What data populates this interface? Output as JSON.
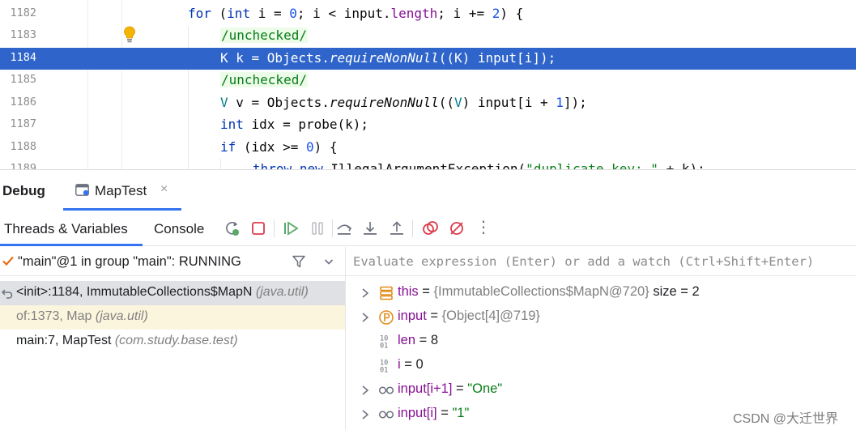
{
  "editor": {
    "lines": [
      {
        "number": "1182"
      },
      {
        "number": "1183"
      },
      {
        "number": "1184"
      },
      {
        "number": "1185"
      },
      {
        "number": "1186"
      },
      {
        "number": "1187"
      },
      {
        "number": "1188"
      },
      {
        "number": "1189"
      }
    ],
    "current_line": "1184",
    "code": {
      "l1182": {
        "kw_for": "for",
        "kw_int": "int",
        "rest1": " i = ",
        "zero": "0",
        "rest2": "; i < input.",
        "length": "length",
        "rest3": "; i += ",
        "two": "2",
        "rest4": ") {"
      },
      "l1183": {
        "comment": "/unchecked/"
      },
      "l1184": {
        "text": "K k = Objects.",
        "method": "requireNonNull",
        "rest": "((K) input[i]);"
      },
      "l1185": {
        "comment": "/unchecked/"
      },
      "l1186": {
        "type_v": "V",
        "rest1": " v = Objects.",
        "method": "requireNonNull",
        "rest2": "((",
        "cast_v": "V",
        "rest3": ") input[i + ",
        "one": "1",
        "rest4": "]);"
      },
      "l1187": {
        "kw_int": "int",
        "rest": " idx = probe(k);"
      },
      "l1188": {
        "kw_if": "if",
        "rest1": " (idx >= ",
        "zero": "0",
        "rest2": ") {"
      },
      "l1189": {
        "kw_throw": "throw",
        "kw_new": "new",
        "rest1": " IllegalArgumentException(",
        "str": "\"duplicate key: \"",
        "rest2": " + k);"
      }
    }
  },
  "debug": {
    "title": "Debug",
    "session_tab": "MapTest",
    "close_glyph": "×"
  },
  "toolbar": {
    "tabs": [
      "Threads & Variables",
      "Console"
    ],
    "active_tab": "Threads & Variables",
    "icons": [
      "rerun-icon",
      "stop-icon",
      "resume-icon",
      "pause-icon",
      "step-over-icon",
      "step-into-icon",
      "step-out-icon",
      "view-breakpoints-icon",
      "mute-breakpoints-icon",
      "more-icon"
    ],
    "more_glyph": "⋮"
  },
  "frames": {
    "thread": "\"main\"@1 in group \"main\": RUNNING",
    "items": [
      {
        "method": "<init>:1184, ImmutableCollections$MapN",
        "package": "(java.util)",
        "state": "selected"
      },
      {
        "method": "of:1373, Map",
        "package": "(java.util)",
        "state": "library"
      },
      {
        "method": "main:7, MapTest",
        "package": "(com.study.base.test)",
        "state": "normal"
      }
    ]
  },
  "variables": {
    "eval_placeholder": "Evaluate expression (Enter) or add a watch (Ctrl+Shift+Enter)",
    "items": [
      {
        "name": "this",
        "op": " = ",
        "value": "{ImmutableCollections$MapN@720}",
        "extra": "  size = 2",
        "icon": "object-icon",
        "expandable": true
      },
      {
        "name": "input",
        "op": " = ",
        "value": "{Object[4]@719}",
        "extra": "",
        "icon": "parameter-icon",
        "expandable": true
      },
      {
        "name": "len",
        "op": " = ",
        "value": "8",
        "extra": "",
        "icon": "primitive-icon",
        "expandable": false
      },
      {
        "name": "i",
        "op": " = ",
        "value": "0",
        "extra": "",
        "icon": "primitive-icon",
        "expandable": false
      },
      {
        "name": "input[i+1]",
        "op": " = ",
        "value": "\"One\"",
        "extra": "",
        "icon": "watch-icon",
        "expandable": true
      },
      {
        "name": "input[i]",
        "op": " = ",
        "value": "\"1\"",
        "extra": "",
        "icon": "watch-icon",
        "expandable": true
      }
    ]
  },
  "watermark": "CSDN @大迁世界",
  "colors": {
    "current_line": "#2f65ca",
    "accent": "#3574f0",
    "keyword": "#0033b3",
    "number": "#1750eb",
    "field": "#871094",
    "string": "#067d17",
    "type_param": "#007e8a",
    "selected_frame": "#dfe1e5",
    "library_frame": "#fcf5de"
  }
}
